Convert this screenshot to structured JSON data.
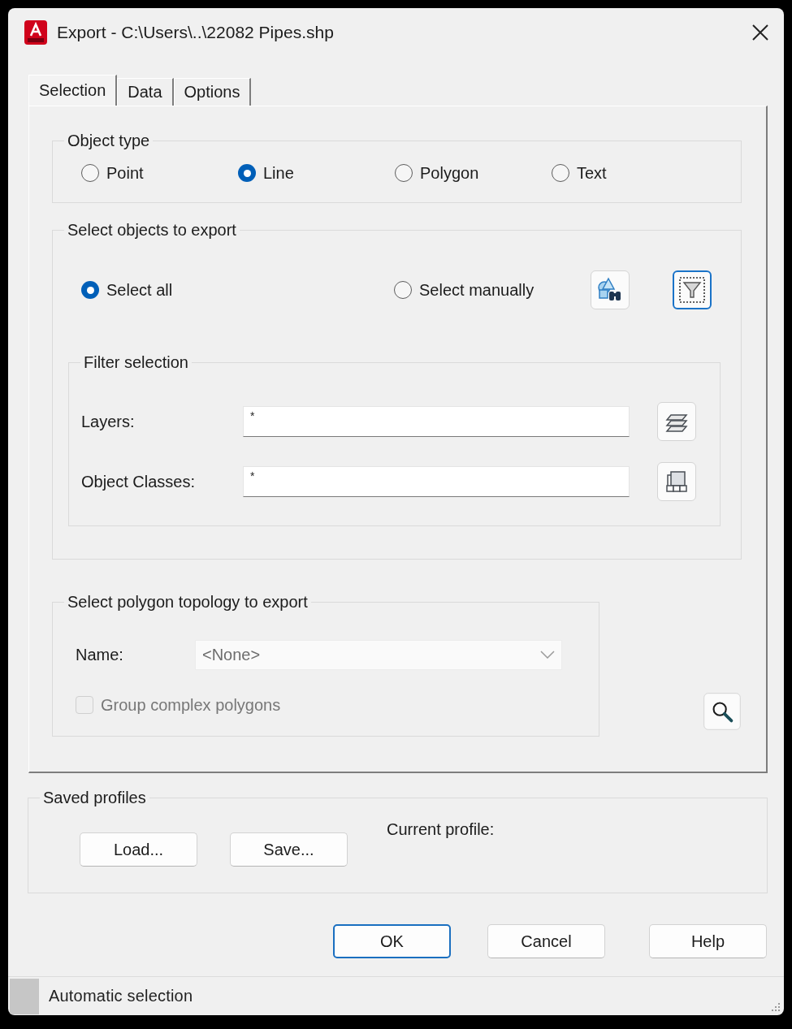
{
  "window": {
    "title": "Export - C:\\Users\\..\\22082 Pipes.shp"
  },
  "tabs": [
    {
      "label": "Selection",
      "selected": true
    },
    {
      "label": "Data",
      "selected": false
    },
    {
      "label": "Options",
      "selected": false
    }
  ],
  "object_type": {
    "title": "Object type",
    "options": [
      {
        "label": "Point",
        "selected": false
      },
      {
        "label": "Line",
        "selected": true
      },
      {
        "label": "Polygon",
        "selected": false
      },
      {
        "label": "Text",
        "selected": false
      }
    ]
  },
  "select_objects": {
    "title": "Select objects to export",
    "options": [
      {
        "label": "Select all",
        "selected": true
      },
      {
        "label": "Select manually",
        "selected": false
      }
    ],
    "tool_buttons": [
      {
        "kind": "find",
        "focused": false
      },
      {
        "kind": "filter",
        "focused": true
      }
    ],
    "filter": {
      "title": "Filter selection",
      "rows": [
        {
          "label": "Layers:",
          "value": "*",
          "button": {
            "kind": "layers"
          }
        },
        {
          "label": "Object Classes:",
          "value": "*",
          "button": {
            "kind": "classes"
          }
        }
      ]
    }
  },
  "polygon_topology": {
    "title": "Select polygon topology to export",
    "name_label": "Name:",
    "name_value": "<None>",
    "disabled": true,
    "group_complex": {
      "label": "Group complex polygons",
      "checked": false,
      "disabled": true
    }
  },
  "saved_profiles": {
    "title": "Saved profiles",
    "buttons": [
      "Load...",
      "Save..."
    ],
    "current_profile_label": "Current profile:"
  },
  "buttons": [
    {
      "label": "OK",
      "default": true
    },
    {
      "label": "Cancel",
      "default": false
    },
    {
      "label": "Help",
      "default": false
    }
  ],
  "status_bar": {
    "text": "Automatic selection"
  }
}
